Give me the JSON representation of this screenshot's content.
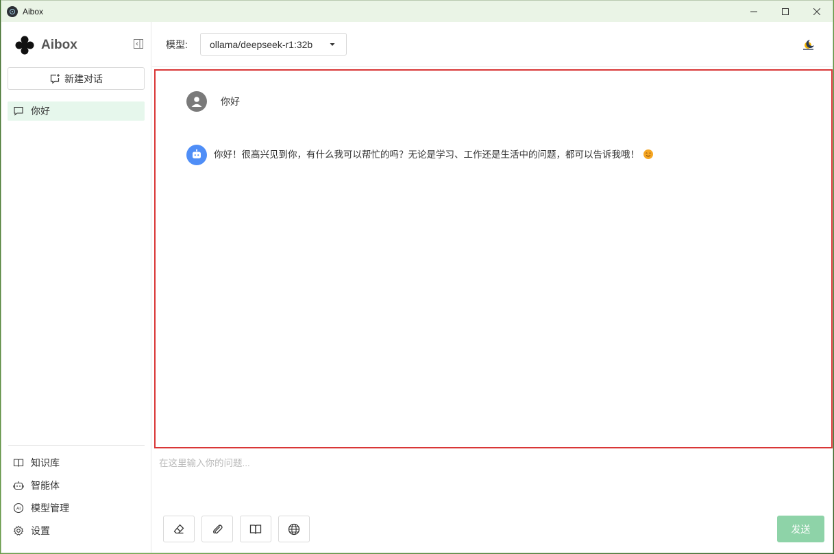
{
  "window": {
    "title": "Aibox"
  },
  "sidebar": {
    "logo_text": "Aibox",
    "new_chat_label": "新建对话",
    "conversations": [
      {
        "label": "你好"
      }
    ],
    "nav": [
      {
        "label": "知识库",
        "icon": "book-icon"
      },
      {
        "label": "智能体",
        "icon": "robot-icon"
      },
      {
        "label": "模型管理",
        "icon": "ai-icon"
      },
      {
        "label": "设置",
        "icon": "gear-icon"
      }
    ]
  },
  "header": {
    "model_label": "模型:",
    "model_value": "ollama/deepseek-r1:32b"
  },
  "chat": {
    "messages": [
      {
        "role": "user",
        "text": "你好"
      },
      {
        "role": "assistant",
        "text": "你好！很高兴见到你，有什么我可以帮忙的吗？无论是学习、工作还是生活中的问题，都可以告诉我哦！"
      }
    ]
  },
  "input": {
    "placeholder": "在这里输入你的问题...",
    "send_label": "发送"
  },
  "colors": {
    "accent": "#8ed3a8",
    "active_item_bg": "#e6f7ec",
    "highlight_border": "#d93636",
    "bot_avatar": "#4f8ef7"
  }
}
